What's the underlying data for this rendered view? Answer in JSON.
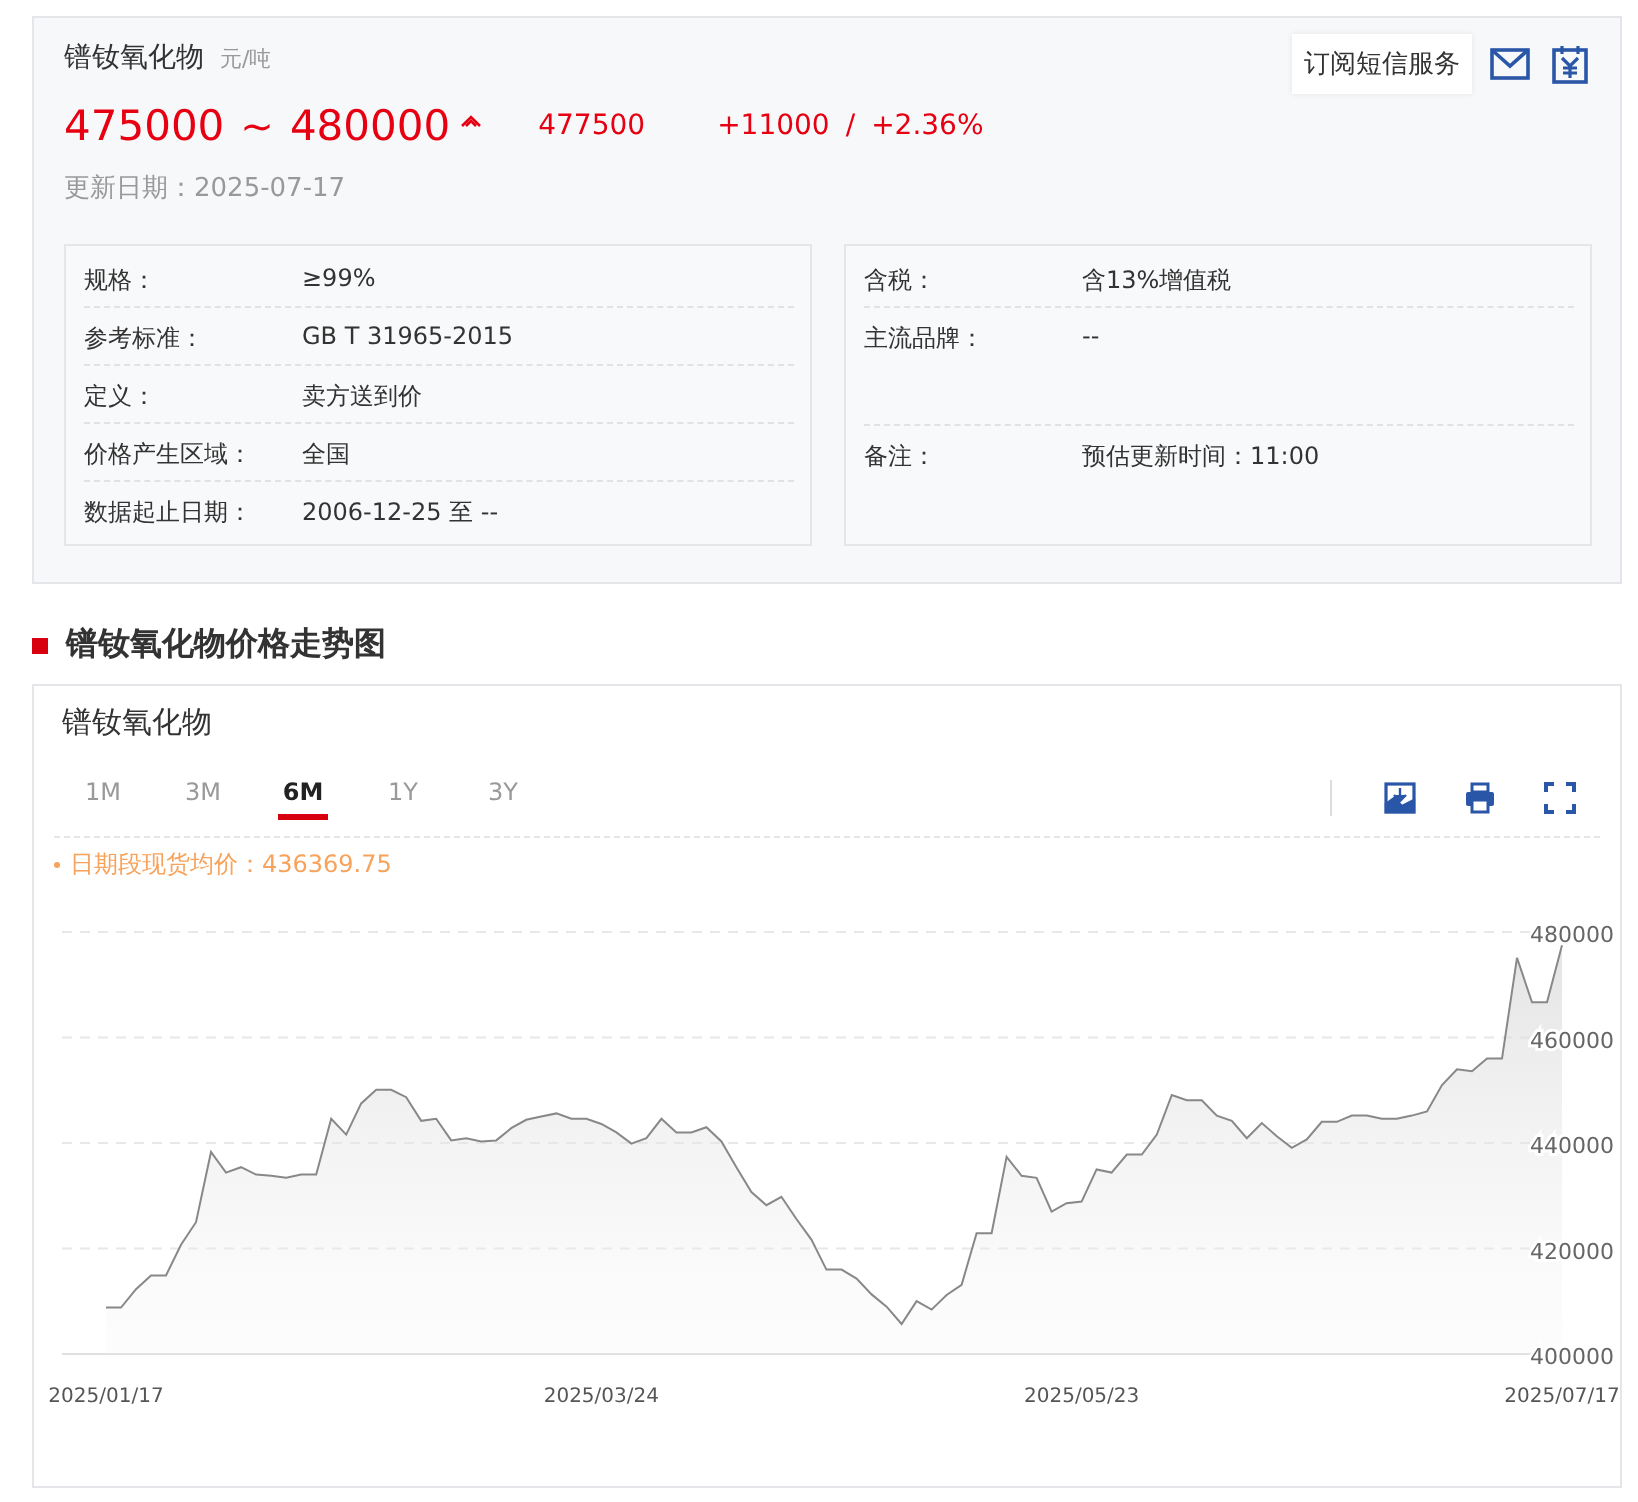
{
  "product": {
    "name": "镨钕氧化物",
    "unit": "元/吨",
    "price_low": "475000",
    "separator": "~",
    "price_high": "480000",
    "rising": true,
    "average": "477500",
    "change": "+11000",
    "change_sep": "/",
    "change_pct": "+2.36%",
    "updated": "更新日期：2025-07-17",
    "subscribe_button": "订阅短信服务"
  },
  "info_left": [
    {
      "label": "规格：",
      "value": "≥99%"
    },
    {
      "label": "参考标准：",
      "value": "GB T 31965-2015"
    },
    {
      "label": "定义：",
      "value": "卖方送到价"
    },
    {
      "label": "价格产生区域：",
      "value": "全国"
    },
    {
      "label": "数据起止日期：",
      "value": "2006-12-25 至 --"
    }
  ],
  "info_right": [
    {
      "label": "含税：",
      "value": "含13%增值税"
    },
    {
      "label": "主流品牌：",
      "value": "--"
    },
    {
      "label": "备注：",
      "value": "预估更新时间：11:00"
    }
  ],
  "section_title": "镨钕氧化物价格走势图",
  "chart_panel": {
    "title": "镨钕氧化物",
    "tabs": [
      {
        "label": "1M",
        "selected": false
      },
      {
        "label": "3M",
        "selected": false
      },
      {
        "label": "6M",
        "selected": true
      },
      {
        "label": "1Y",
        "selected": false
      },
      {
        "label": "3Y",
        "selected": false
      }
    ],
    "average_note": "日期段现货均价：436369.75",
    "chart_data": {
      "type": "area",
      "categories": [
        "2025/01/17",
        null,
        null,
        null,
        null,
        null,
        null,
        null,
        null,
        null,
        null,
        null,
        null,
        null,
        null,
        null,
        null,
        null,
        null,
        null,
        null,
        null,
        null,
        null,
        null,
        null,
        null,
        null,
        null,
        null,
        null,
        null,
        null,
        "2025/03/24",
        null,
        null,
        null,
        null,
        null,
        null,
        null,
        null,
        null,
        null,
        null,
        null,
        null,
        null,
        null,
        null,
        null,
        null,
        null,
        null,
        null,
        null,
        null,
        null,
        null,
        null,
        null,
        null,
        null,
        null,
        null,
        "2025/05/23",
        null,
        null,
        null,
        null,
        null,
        null,
        null,
        null,
        null,
        null,
        null,
        null,
        null,
        null,
        null,
        null,
        null,
        null,
        null,
        null,
        null,
        null,
        null,
        null,
        null,
        null,
        null,
        null,
        null,
        null,
        null,
        "2025/07/17"
      ],
      "series": [
        {
          "color": "#888888",
          "values": [
            408800,
            408800,
            412300,
            414900,
            414900,
            420700,
            425000,
            438300,
            434400,
            435400,
            434000,
            433800,
            433400,
            434000,
            434000,
            444600,
            441600,
            447500,
            450100,
            450100,
            448700,
            444200,
            444600,
            440500,
            440900,
            440300,
            440500,
            442800,
            444400,
            445000,
            445600,
            444600,
            444600,
            443600,
            442000,
            439900,
            440900,
            444600,
            442000,
            442000,
            443000,
            440300,
            435400,
            430700,
            428200,
            429800,
            425600,
            421700,
            416000,
            416000,
            414300,
            411300,
            409000,
            405700,
            410000,
            408400,
            411200,
            413100,
            422900,
            422900,
            437400,
            433800,
            433400,
            427000,
            428600,
            428900,
            435000,
            434400,
            437800,
            437800,
            441600,
            449100,
            448100,
            448100,
            445200,
            444200,
            440900,
            443800,
            441300,
            439100,
            440700,
            444000,
            444000,
            445200,
            445200,
            444600,
            444600,
            445200,
            446000,
            451000,
            454000,
            453600,
            456000,
            456000,
            475100,
            466700,
            466700,
            477500
          ]
        }
      ],
      "ylim": [
        400000,
        480000
      ],
      "grid": true,
      "yticks": [
        400000,
        420000,
        440000,
        460000,
        480000
      ]
    }
  }
}
